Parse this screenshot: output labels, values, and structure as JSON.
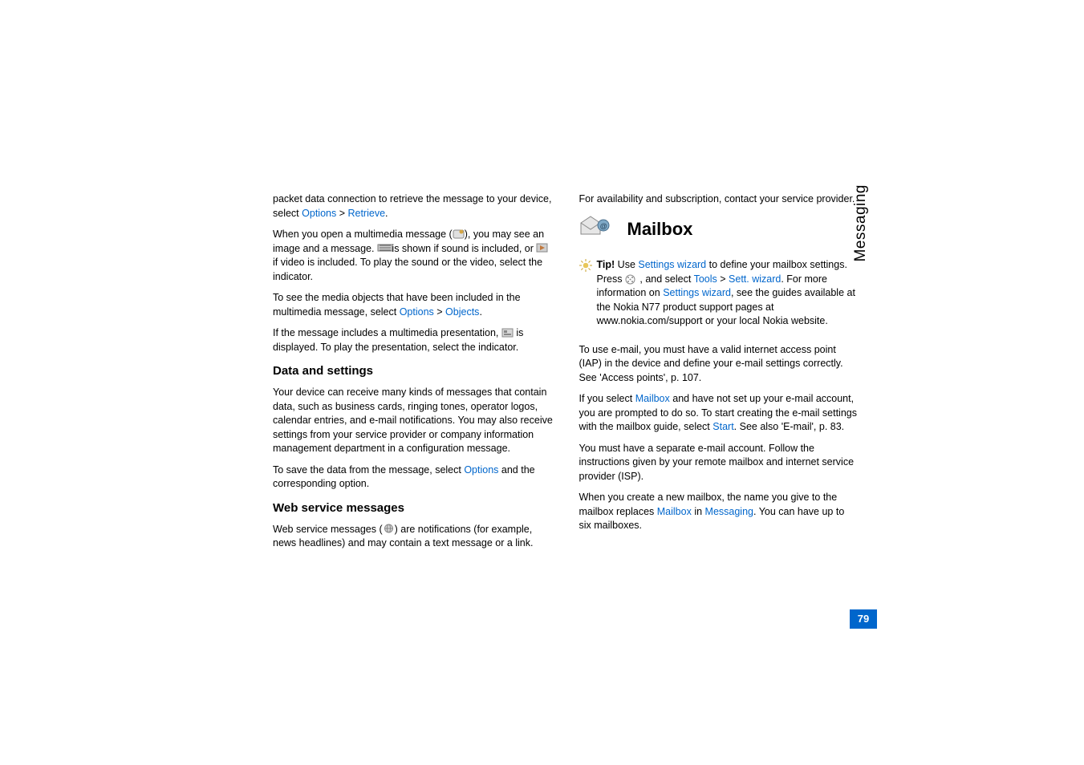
{
  "side_tab": "Messaging",
  "page_number": "79",
  "col1": {
    "p1_a": "packet data connection to retrieve the message to your device, select ",
    "p1_b": "Options",
    "p1_c": " > ",
    "p1_d": "Retrieve",
    "p1_e": ".",
    "p2_a": "When you open a multimedia message (",
    "p2_b": "), you may see an image and a message. ",
    "p2_c": " is shown if sound is included, or ",
    "p2_d": " if video is included. To play the sound or the video, select the indicator.",
    "p3_a": "To see the media objects that have been included in the multimedia message, select ",
    "p3_b": "Options",
    "p3_c": " > ",
    "p3_d": "Objects",
    "p3_e": ".",
    "p4_a": "If the message includes a multimedia presentation, ",
    "p4_b": " is displayed. To play the presentation, select the indicator.",
    "h_data": "Data and settings",
    "p5": "Your device can receive many kinds of messages that contain data, such as business cards, ringing tones, operator logos, calendar entries, and e-mail notifications. You may also receive settings from your service provider or company information management department in a configuration message.",
    "p6_a": "To save the data from the message, select ",
    "p6_b": "Options",
    "p6_c": " and the corresponding option.",
    "h_web": "Web service messages",
    "p7_a": "Web service messages (",
    "p7_b": ") are notifications (for example, news headlines) and may contain a text message or a link."
  },
  "col2": {
    "p1": "For availability and subscription, contact your service provider.",
    "h_mailbox": "Mailbox",
    "tip_a": "Tip!",
    "tip_b": " Use ",
    "tip_c": "Settings wizard",
    "tip_d": " to define your mailbox settings. Press ",
    "tip_e": " , and select ",
    "tip_f": "Tools",
    "tip_g": " > ",
    "tip_h": "Sett. wizard",
    "tip_i": ". For more information on ",
    "tip_j": "Settings wizard",
    "tip_k": ", see the guides available at the Nokia N77 product support pages at www.nokia.com/support or your local Nokia website.",
    "p3": "To use e-mail, you must have a valid internet access point (IAP) in the device and define your e-mail settings correctly. See 'Access points', p. 107.",
    "p4_a": "If you select ",
    "p4_b": "Mailbox",
    "p4_c": " and have not set up your e-mail account, you are prompted to do so. To start creating the e-mail settings with the mailbox guide, select ",
    "p4_d": "Start",
    "p4_e": ". See also 'E-mail', p. 83.",
    "p5": "You must have a separate e-mail account. Follow the instructions given by your remote mailbox and internet service provider (ISP).",
    "p6_a": "When you create a new mailbox, the name you give to the mailbox replaces ",
    "p6_b": "Mailbox",
    "p6_c": " in ",
    "p6_d": "Messaging",
    "p6_e": ". You can have up to six mailboxes."
  }
}
